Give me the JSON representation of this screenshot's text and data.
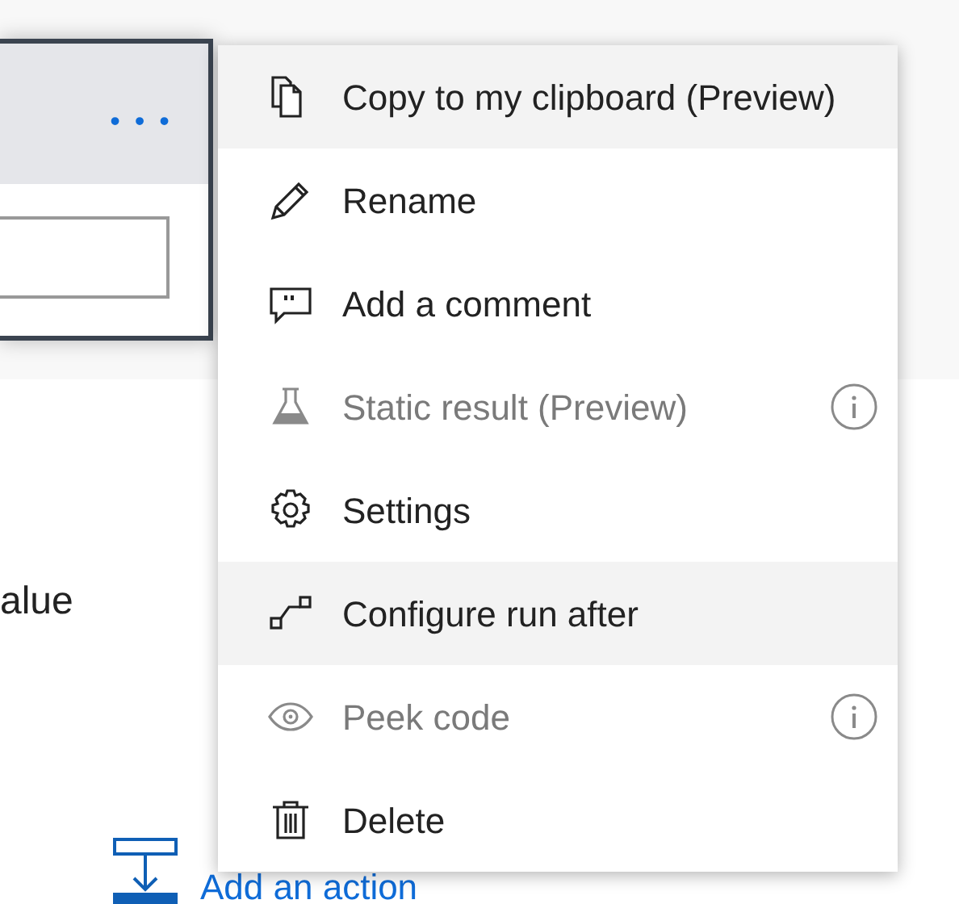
{
  "card": {
    "more_button": "• • •"
  },
  "field_label": "alue",
  "add_action": {
    "label": "Add an action"
  },
  "menu": {
    "items": [
      {
        "kind": "copy",
        "label": "Copy to my clipboard (Preview)",
        "highlighted": true,
        "disabled": false
      },
      {
        "kind": "rename",
        "label": "Rename",
        "highlighted": false,
        "disabled": false
      },
      {
        "kind": "comment",
        "label": "Add a comment",
        "highlighted": false,
        "disabled": false
      },
      {
        "kind": "static",
        "label": "Static result (Preview)",
        "highlighted": false,
        "disabled": true,
        "info": true
      },
      {
        "kind": "settings",
        "label": "Settings",
        "highlighted": false,
        "disabled": false
      },
      {
        "kind": "runafter",
        "label": "Configure run after",
        "highlighted": true,
        "disabled": false
      },
      {
        "kind": "peek",
        "label": "Peek code",
        "highlighted": false,
        "disabled": true,
        "info": true
      },
      {
        "kind": "delete",
        "label": "Delete",
        "highlighted": false,
        "disabled": false
      }
    ]
  }
}
